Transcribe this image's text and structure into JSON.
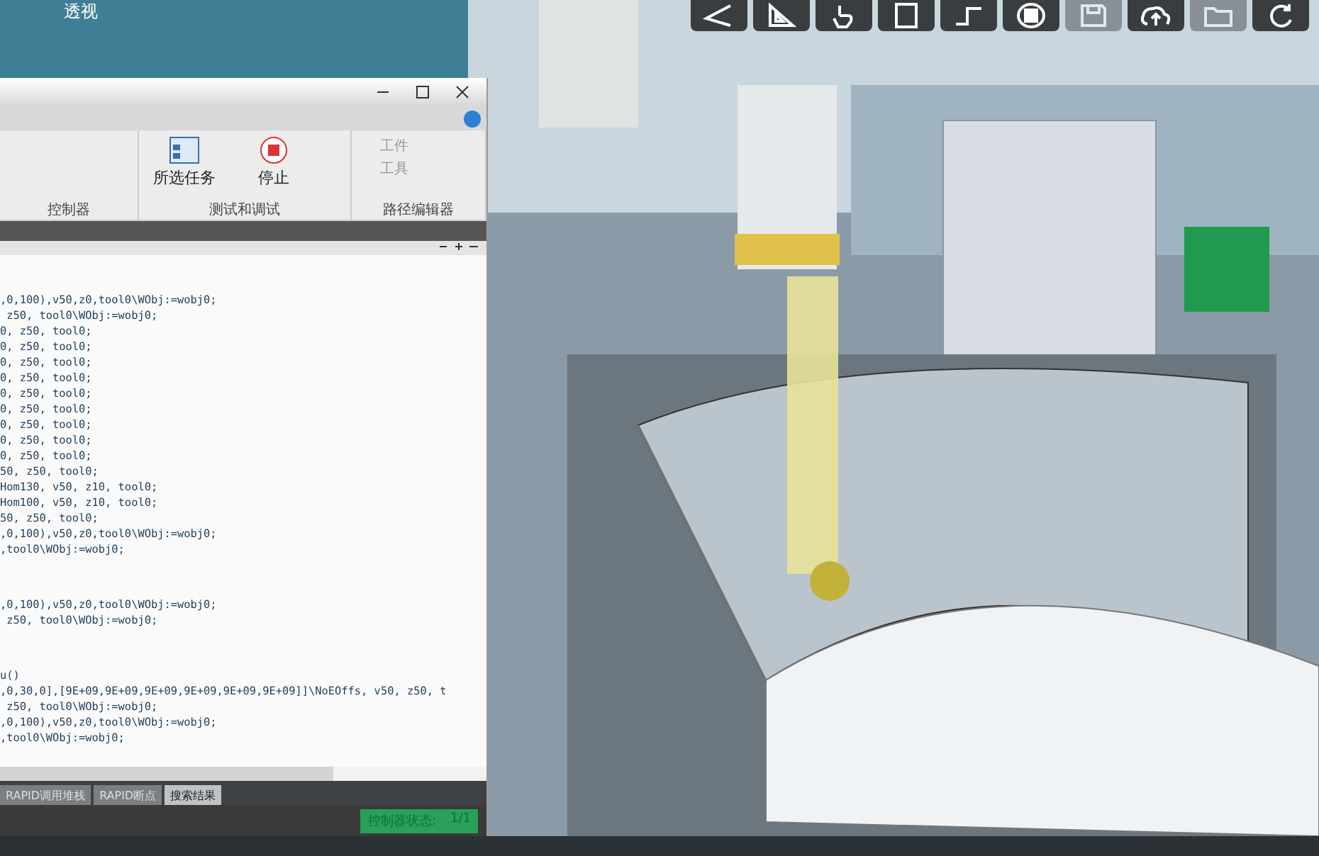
{
  "scene": {
    "view_label": "透视"
  },
  "toolbar": {
    "buttons": [
      {
        "kind": "angle",
        "disabled": false
      },
      {
        "kind": "ruler",
        "disabled": false
      },
      {
        "kind": "hand",
        "disabled": false
      },
      {
        "kind": "frame",
        "disabled": false
      },
      {
        "kind": "path",
        "disabled": false
      },
      {
        "kind": "rotate",
        "disabled": false
      },
      {
        "kind": "save",
        "disabled": true
      },
      {
        "kind": "upload",
        "disabled": false
      },
      {
        "kind": "folder",
        "disabled": true
      },
      {
        "kind": "refresh",
        "disabled": false
      }
    ]
  },
  "editor_window": {
    "ribbon": {
      "groups": [
        {
          "label": "控制器"
        },
        {
          "label": "测试和调试",
          "buttons": [
            {
              "label": "所选任务",
              "kind": "tasks"
            },
            {
              "label": "停止",
              "kind": "stop"
            }
          ]
        },
        {
          "label": "路径编辑器",
          "buttons": [
            {
              "label": "工件",
              "kind": "small"
            },
            {
              "label": "工具",
              "kind": "small"
            }
          ]
        }
      ]
    },
    "code_blocks": [
      [
        ",0,100),v50,z0,tool0\\WObj:=wobj0;",
        " z50, tool0\\WObj:=wobj0;",
        "0, z50, tool0;",
        "0, z50, tool0;",
        "0, z50, tool0;",
        "0, z50, tool0;",
        "0, z50, tool0;",
        "0, z50, tool0;",
        "0, z50, tool0;",
        "0, z50, tool0;",
        "0, z50, tool0;",
        "50, z50, tool0;",
        "Hom130, v50, z10, tool0;",
        "Hom100, v50, z10, tool0;",
        "50, z50, tool0;",
        ",0,100),v50,z0,tool0\\WObj:=wobj0;",
        ",tool0\\WObj:=wobj0;"
      ],
      [
        ",0,100),v50,z0,tool0\\WObj:=wobj0;",
        " z50, tool0\\WObj:=wobj0;"
      ],
      [
        "u()",
        ",0,30,0],[9E+09,9E+09,9E+09,9E+09,9E+09,9E+09]]\\NoEOffs, v50, z50, t",
        " z50, tool0\\WObj:=wobj0;",
        ",0,100),v50,z0,tool0\\WObj:=wobj0;",
        ",tool0\\WObj:=wobj0;"
      ]
    ],
    "tabs": [
      {
        "label": "RAPID调用堆栈",
        "selected": false
      },
      {
        "label": "RAPID断点",
        "selected": false
      },
      {
        "label": "搜索结果",
        "selected": true
      }
    ],
    "status": {
      "label": "控制器状态:",
      "value": "1/1"
    }
  }
}
